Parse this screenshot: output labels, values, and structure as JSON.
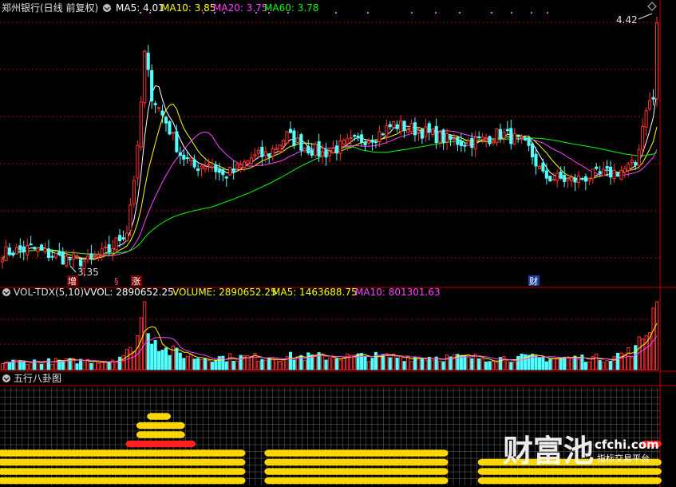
{
  "price_panel": {
    "title": "郑州银行(日线 前复权)",
    "ma_labels": [
      {
        "text": "MA5: 4.01",
        "color": "#ffffff"
      },
      {
        "text": "MA10: 3.85",
        "color": "#ffff00"
      },
      {
        "text": "MA20: 3.75",
        "color": "#ff44ff"
      },
      {
        "text": "MA60: 3.78",
        "color": "#00ff00"
      }
    ],
    "high_label": "4.42",
    "low_label": "3.35",
    "markers": [
      "增",
      "§",
      "涨",
      "财"
    ]
  },
  "volume_panel": {
    "title": "VOL-TDX(5,10)",
    "labels": [
      {
        "text": "VVOL: 2890652.25",
        "color": "#ffffff"
      },
      {
        "text": "VOLUME: 2890652.25",
        "color": "#ffff00"
      },
      {
        "text": "MA5: 1463688.75",
        "color": "#ffff00"
      },
      {
        "text": "MA10: 801301.63",
        "color": "#ff44ff"
      }
    ]
  },
  "indicator_panel": {
    "title": "五行八卦图"
  },
  "watermark": {
    "main": "财富池",
    "site": "cfchi.com",
    "sub": "指标交易平台"
  },
  "colors": {
    "up": "#ff3232",
    "down": "#54ffff",
    "ma5": "#ffffff",
    "ma10": "#ffff00",
    "ma20": "#ff44ff",
    "ma60": "#00ff00",
    "grid": "#a00000",
    "dot_yellow": "#ffd700",
    "dot_red": "#ff2020"
  },
  "chart_data": {
    "type": "candlestick",
    "close_anchors": [
      [
        0,
        3.4
      ],
      [
        8,
        3.42
      ],
      [
        16,
        3.38
      ],
      [
        24,
        3.36
      ],
      [
        30,
        3.41
      ],
      [
        35,
        3.5
      ],
      [
        38,
        3.85
      ],
      [
        40,
        4.28
      ],
      [
        42,
        4.1
      ],
      [
        46,
        3.98
      ],
      [
        50,
        3.84
      ],
      [
        54,
        3.78
      ],
      [
        58,
        3.8
      ],
      [
        62,
        3.74
      ],
      [
        66,
        3.77
      ],
      [
        70,
        3.82
      ],
      [
        75,
        3.84
      ],
      [
        80,
        3.92
      ],
      [
        85,
        3.87
      ],
      [
        90,
        3.84
      ],
      [
        95,
        3.87
      ],
      [
        100,
        3.9
      ],
      [
        105,
        3.92
      ],
      [
        110,
        3.97
      ],
      [
        115,
        3.95
      ],
      [
        120,
        3.93
      ],
      [
        125,
        3.9
      ],
      [
        130,
        3.89
      ],
      [
        135,
        3.9
      ],
      [
        140,
        3.93
      ],
      [
        145,
        3.9
      ],
      [
        148,
        3.86
      ],
      [
        152,
        3.74
      ],
      [
        156,
        3.73
      ],
      [
        160,
        3.72
      ],
      [
        165,
        3.74
      ],
      [
        170,
        3.75
      ],
      [
        175,
        3.77
      ],
      [
        178,
        3.79
      ],
      [
        181,
        4.05
      ],
      [
        183,
        4.08
      ],
      [
        184,
        4.42
      ]
    ],
    "volume_anchors": [
      [
        0,
        0.12
      ],
      [
        30,
        0.14
      ],
      [
        36,
        0.28
      ],
      [
        38,
        0.55
      ],
      [
        40,
        0.98
      ],
      [
        42,
        0.55
      ],
      [
        46,
        0.3
      ],
      [
        55,
        0.18
      ],
      [
        80,
        0.2
      ],
      [
        110,
        0.2
      ],
      [
        140,
        0.18
      ],
      [
        170,
        0.18
      ],
      [
        178,
        0.3
      ],
      [
        181,
        0.6
      ],
      [
        184,
        1.0
      ]
    ],
    "price_range": [
      3.3,
      4.45
    ],
    "n_bars": 185,
    "dot_columns": [
      {
        "from": 0,
        "to": 68,
        "rows": 4,
        "top_from": 36,
        "top_to": 54,
        "top_rows": 2
      },
      {
        "from": 75,
        "to": 125,
        "rows": 4
      },
      {
        "from": 135,
        "to": 185,
        "rows": 3
      }
    ]
  }
}
